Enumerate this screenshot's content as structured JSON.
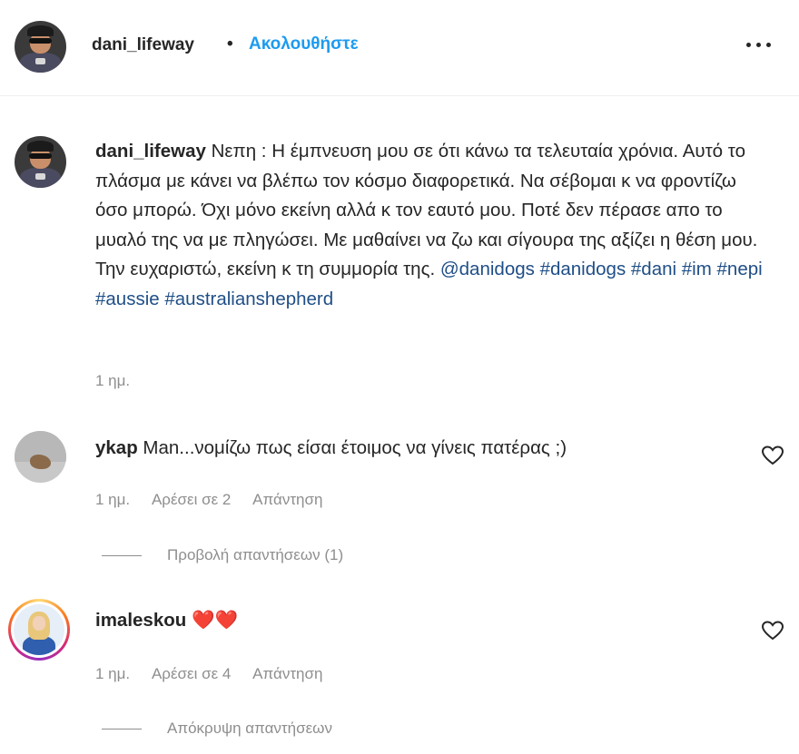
{
  "header": {
    "username": "dani_lifeway",
    "separator": "•",
    "follow_label": "Ακολουθήστε",
    "more_icon": "more-horizontal-icon"
  },
  "caption": {
    "username": "dani_lifeway",
    "text": " Νεπη : Η έμπνευση μου σε ότι κάνω τα τελευταία χρόνια. Αυτό το πλάσμα με κάνει να βλέπω τον κόσμο διαφορετικά. Να σέβομαι κ να φροντίζω όσο μπορώ. Όχι μόνο εκείνη αλλά κ τον εαυτό μου. Ποτέ δεν πέρασε απο το μυαλό της να με πληγώσει. Με μαθαίνει να ζω και σίγουρα της αξίζει η θέση μου. Την ευχαριστώ, εκείνη κ τη συμμορία της. ",
    "mention": "@danidogs",
    "hashtags": [
      "#danidogs",
      "#dani",
      "#im",
      "#nepi",
      "#aussie",
      "#australianshepherd"
    ],
    "time": "1 ημ."
  },
  "comments": [
    {
      "username": "ykap",
      "text": " Man...νομίζω πως είσαι έτοιμος να γίνεις πατέρας ;)",
      "time": "1 ημ.",
      "likes": "Αρέσει σε 2",
      "reply_label": "Απάντηση",
      "replies_toggle": "Προβολή απαντήσεων (1)"
    },
    {
      "username": "imaleskou",
      "text": " ❤️❤️",
      "time": "1 ημ.",
      "likes": "Αρέσει σε 4",
      "reply_label": "Απάντηση",
      "replies_toggle": "Απόκρυψη απαντήσεων"
    }
  ],
  "colors": {
    "link": "#1d9bf0",
    "hashtag": "#1f4e86",
    "muted": "#8e8e8e",
    "text": "#262626"
  }
}
